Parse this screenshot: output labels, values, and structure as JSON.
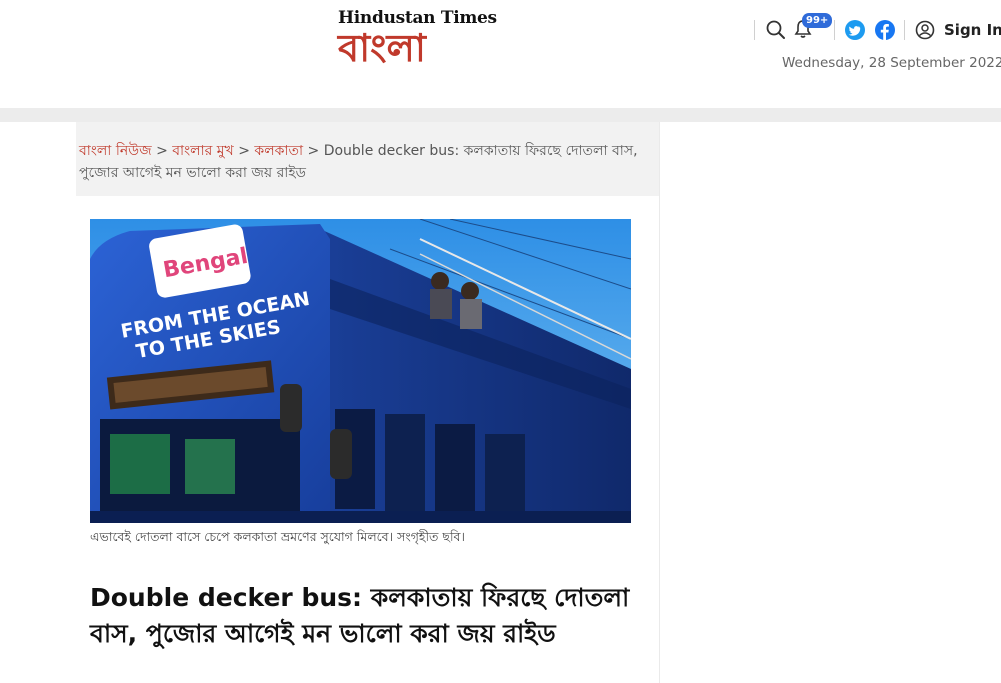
{
  "header": {
    "logo_top": "Hindustan Times",
    "logo_bottom": "বাংলা",
    "notification_badge": "99+",
    "signin_label": "Sign In",
    "date": "Wednesday, 28 September 2022",
    "icons": [
      "search-icon",
      "bell-icon",
      "twitter-icon",
      "facebook-icon",
      "user-icon"
    ]
  },
  "breadcrumb": {
    "items": [
      "বাংলা নিউজ",
      "বাংলার মুখ",
      "কলকাতা"
    ],
    "separator": " > ",
    "current": "Double decker bus: কলকাতায় ফিরছে দোতলা বাস, পুজোর আগেই মন ভালো করা জয় রাইড"
  },
  "article": {
    "image_text_1": "FROM THE OCEAN",
    "image_text_2": "TO THE SKIES",
    "image_brand": "Bengal",
    "caption": "এভাবেই দোতলা বাসে চেপে কলকাতা ভ্রমণের সুযোগ মিলবে। সংগৃহীত ছবি।",
    "headline": "Double decker bus: কলকাতায় ফিরছে দোতলা বাস, পুজোর আগেই মন ভালো করা জয় রাইড"
  },
  "colors": {
    "brand_red": "#c0392b",
    "badge_blue": "#2f6bd9",
    "twitter_blue": "#1d9bf0",
    "facebook_blue": "#1877f2",
    "bus_blue": "#1f4fb8"
  }
}
